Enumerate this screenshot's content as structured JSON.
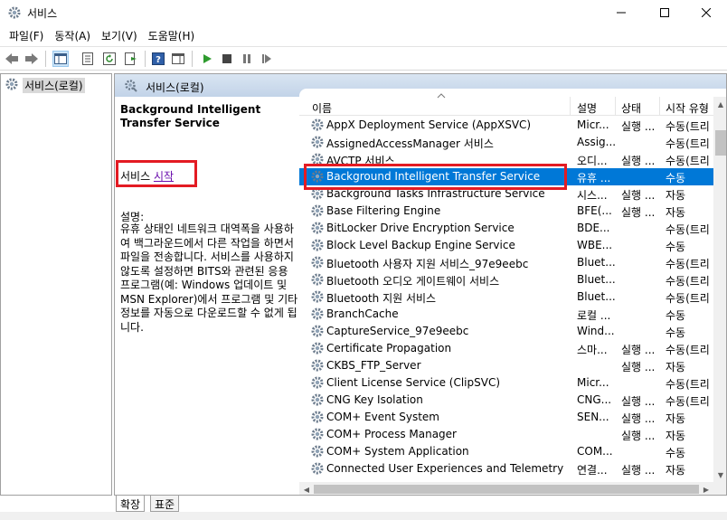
{
  "window": {
    "title": "서비스"
  },
  "menu": [
    "파일(F)",
    "동작(A)",
    "보기(V)",
    "도움말(H)"
  ],
  "tree": {
    "root_label": "서비스(로컬)"
  },
  "pane_header": {
    "title": "서비스(로컬)"
  },
  "detail": {
    "service_name": "Background Intelligent Transfer Service",
    "start_prefix": "서비스 ",
    "start_link": "시작",
    "desc_label": "설명:",
    "description": "유휴 상태인 네트워크 대역폭을 사용하여 백그라운드에서 다른 작업을 하면서 파일을 전송합니다. 서비스를 사용하지 않도록 설정하면 BITS와 관련된 응용 프로그램(예: Windows 업데이트 및 MSN Explorer)에서 프로그램 및 기타 정보를 자동으로 다운로드할 수 없게 됩니다."
  },
  "columns": {
    "name": "이름",
    "desc": "설명",
    "status": "상태",
    "startup": "시작 유형"
  },
  "services": [
    {
      "name": "AppX Deployment Service (AppXSVC)",
      "desc": "Micr...",
      "status": "실행 ...",
      "startup": "수동(트리"
    },
    {
      "name": "AssignedAccessManager 서비스",
      "desc": "Assig...",
      "status": "",
      "startup": "수동(트리"
    },
    {
      "name": "AVCTP 서비스",
      "desc": "오디...",
      "status": "실행 ...",
      "startup": "수동(트리"
    },
    {
      "name": "Background Intelligent Transfer Service",
      "desc": "유휴 ...",
      "status": "",
      "startup": "수동"
    },
    {
      "name": "Background Tasks Infrastructure Service",
      "desc": "시스...",
      "status": "실행 ...",
      "startup": "자동"
    },
    {
      "name": "Base Filtering Engine",
      "desc": "BFE(...",
      "status": "실행 ...",
      "startup": "자동"
    },
    {
      "name": "BitLocker Drive Encryption Service",
      "desc": "BDE...",
      "status": "",
      "startup": "수동(트리"
    },
    {
      "name": "Block Level Backup Engine Service",
      "desc": "WBE...",
      "status": "",
      "startup": "수동"
    },
    {
      "name": "Bluetooth 사용자 지원 서비스_97e9eebc",
      "desc": "Bluet...",
      "status": "",
      "startup": "수동(트리"
    },
    {
      "name": "Bluetooth 오디오 게이트웨이 서비스",
      "desc": "Bluet...",
      "status": "",
      "startup": "수동(트리"
    },
    {
      "name": "Bluetooth 지원 서비스",
      "desc": "Bluet...",
      "status": "",
      "startup": "수동(트리"
    },
    {
      "name": "BranchCache",
      "desc": "로컬 ...",
      "status": "",
      "startup": "수동"
    },
    {
      "name": "CaptureService_97e9eebc",
      "desc": "Wind...",
      "status": "",
      "startup": "수동"
    },
    {
      "name": "Certificate Propagation",
      "desc": "스마...",
      "status": "실행 ...",
      "startup": "수동(트리"
    },
    {
      "name": "CKBS_FTP_Server",
      "desc": "",
      "status": "실행 ...",
      "startup": "자동"
    },
    {
      "name": "Client License Service (ClipSVC)",
      "desc": "Micr...",
      "status": "",
      "startup": "수동(트리"
    },
    {
      "name": "CNG Key Isolation",
      "desc": "CNG...",
      "status": "실행 ...",
      "startup": "수동(트리"
    },
    {
      "name": "COM+ Event System",
      "desc": "SEN...",
      "status": "실행 ...",
      "startup": "자동"
    },
    {
      "name": "COM+ Process Manager",
      "desc": "",
      "status": "실행 ...",
      "startup": "자동"
    },
    {
      "name": "COM+ System Application",
      "desc": "COM...",
      "status": "",
      "startup": "수동"
    },
    {
      "name": "Connected User Experiences and Telemetry",
      "desc": "연결...",
      "status": "실행 ...",
      "startup": "자동"
    }
  ],
  "tabs": [
    "확장",
    "표준"
  ],
  "colors": {
    "selection": "#0078d7",
    "highlight_box": "#e31b23",
    "header_bg": "#c9d8ea"
  }
}
